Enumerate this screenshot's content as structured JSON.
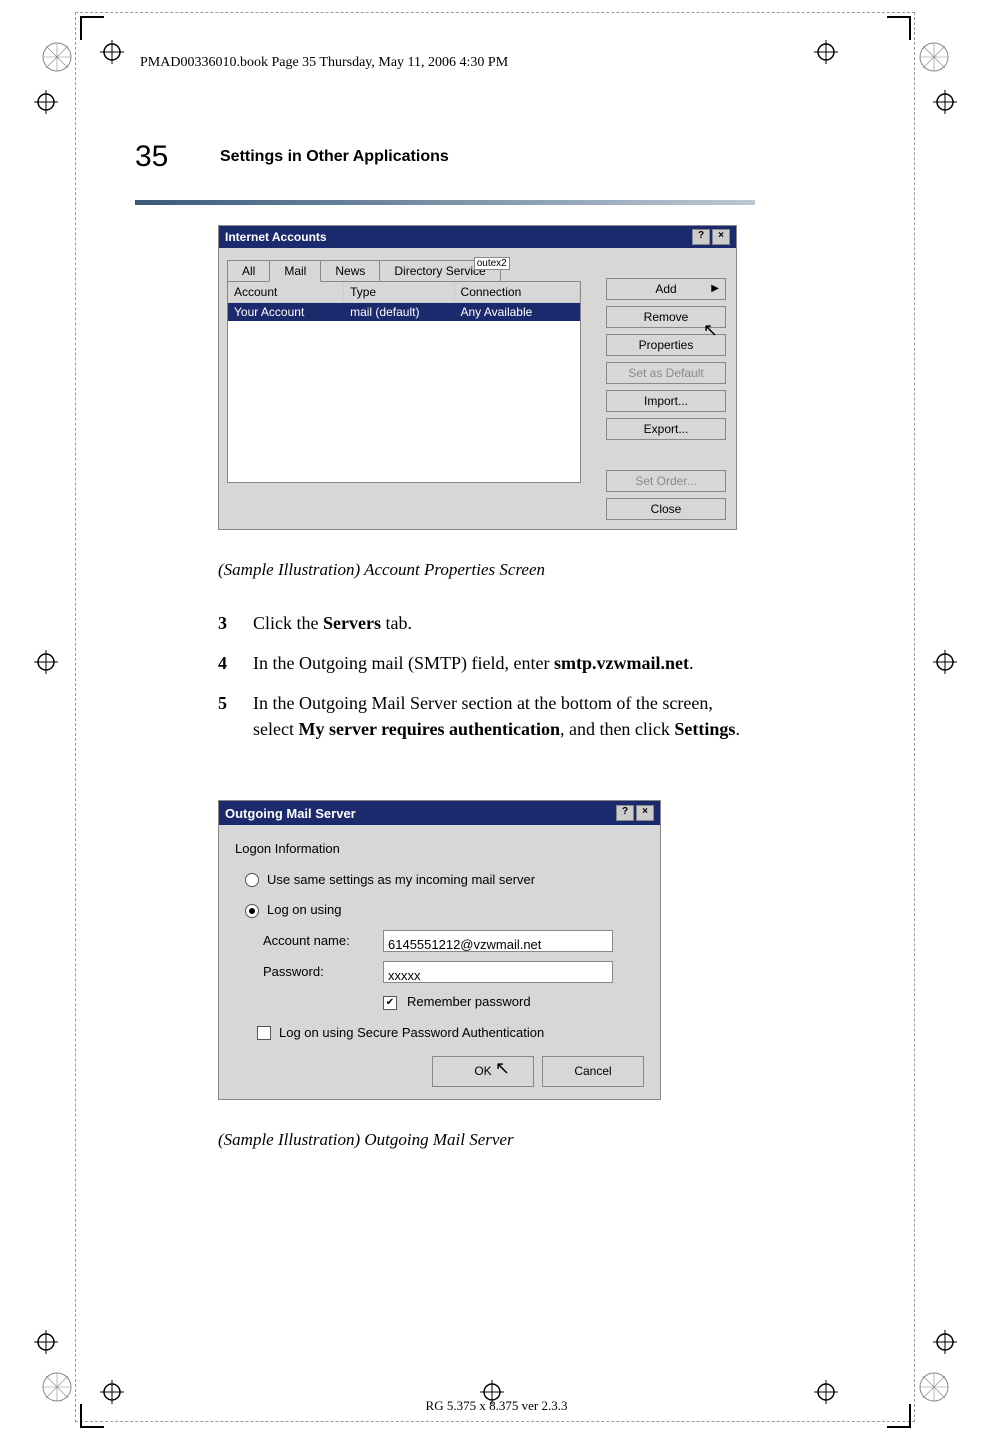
{
  "header": "PMAD00336010.book  Page 35  Thursday, May 11, 2006  4:30 PM",
  "page_number": "35",
  "section_title": "Settings in Other Applications",
  "footer": "RG 5.375 x 8.375 ver 2.3.3",
  "caption1": "(Sample Illustration) Account Properties Screen",
  "caption2": "(Sample Illustration) Outgoing Mail Server",
  "steps": {
    "s3": {
      "num": "3",
      "pre": "Click the ",
      "bold": "Servers",
      "post": " tab."
    },
    "s4": {
      "num": "4",
      "pre": "In the Outgoing mail (SMTP) field, enter ",
      "bold": "smtp.vzwmail.net",
      "post": "."
    },
    "s5": {
      "num": "5",
      "pre": "In the Outgoing Mail Server section at the bottom of the screen, select ",
      "bold": "My server requires authentication",
      "mid": ", and then click ",
      "bold2": "Settings",
      "post": "."
    }
  },
  "dialog1": {
    "title": "Internet Accounts",
    "tabs": {
      "all": "All",
      "mail": "Mail",
      "news": "News",
      "dir": "Directory Service",
      "overlay": "outex2"
    },
    "columns": {
      "account": "Account",
      "type": "Type",
      "connection": "Connection"
    },
    "row": {
      "account": "Your Account",
      "type": "mail (default)",
      "connection": "Any Available"
    },
    "buttons": {
      "add": "Add",
      "remove": "Remove",
      "properties": "Properties",
      "setdefault": "Set as Default",
      "import": "Import...",
      "export": "Export...",
      "setorder": "Set Order...",
      "close": "Close"
    }
  },
  "dialog2": {
    "title": "Outgoing Mail Server",
    "group": "Logon Information",
    "radio_same": "Use same settings as my incoming mail server",
    "radio_logon": "Log on using",
    "account_label": "Account name:",
    "account_value": "6145551212@vzwmail.net",
    "password_label": "Password:",
    "password_value": "xxxxx",
    "remember": "Remember password",
    "spa": "Log on using Secure Password Authentication",
    "ok": "OK",
    "cancel": "Cancel"
  }
}
